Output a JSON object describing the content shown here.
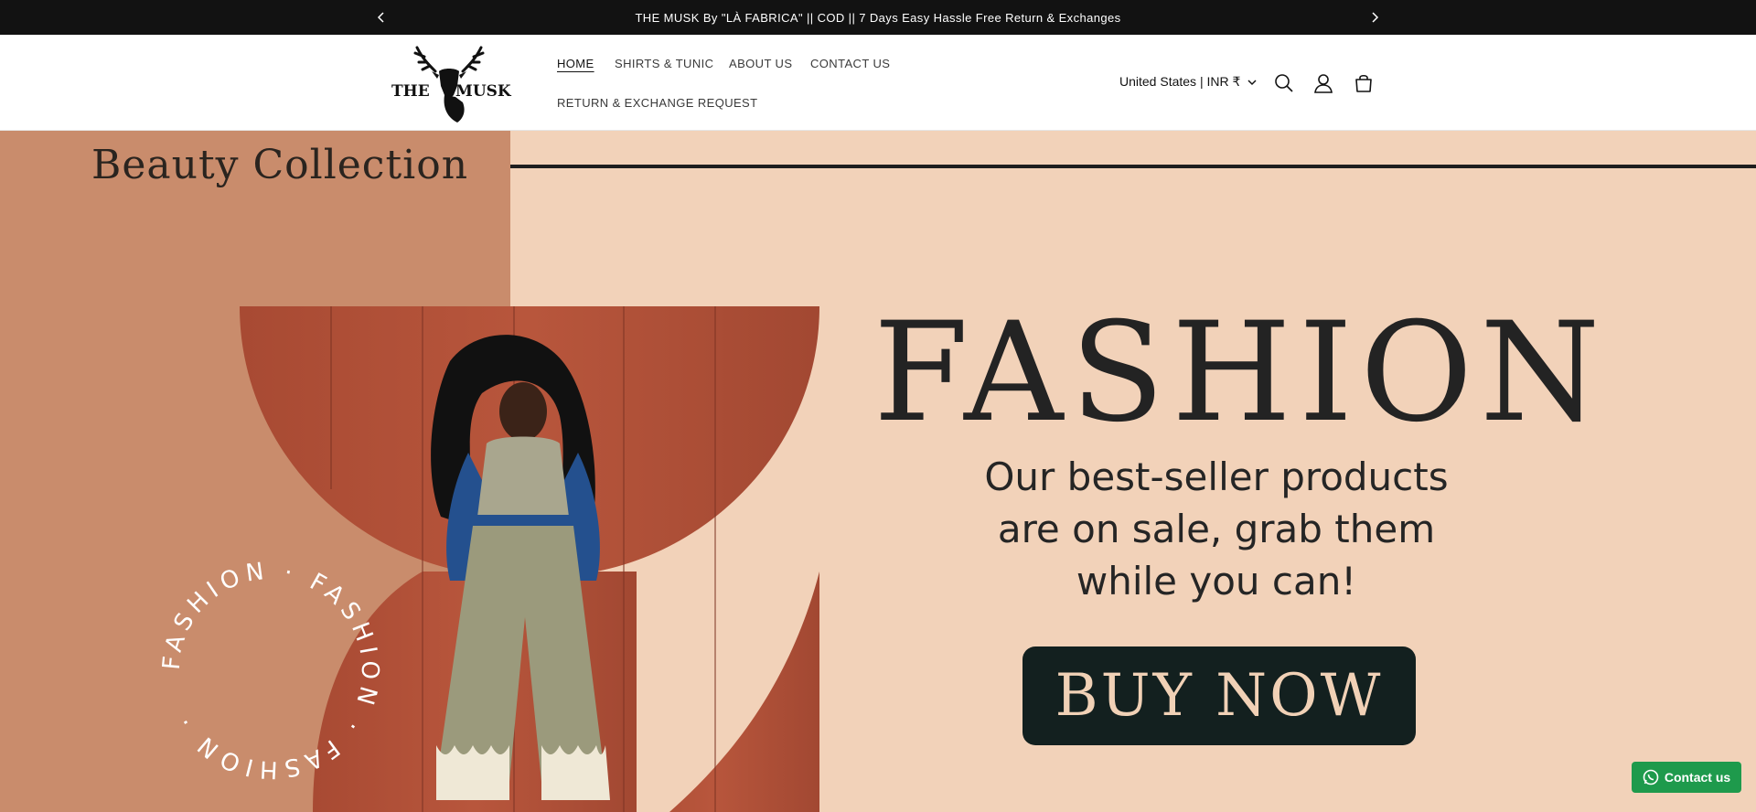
{
  "announcement": {
    "message": "THE MUSK By \"LÀ FABRICA\" || COD || 7 Days Easy Hassle Free Return & Exchanges",
    "prev_icon": "chevron-left-icon",
    "next_icon": "chevron-right-icon"
  },
  "header": {
    "logo": {
      "line1": "THE",
      "line2": "MUSK"
    },
    "nav": [
      {
        "label": "HOME",
        "active": true
      },
      {
        "label": "SHIRTS & TUNIC",
        "active": false
      },
      {
        "label": "ABOUT US",
        "active": false
      },
      {
        "label": "CONTACT US",
        "active": false
      },
      {
        "label": "RETURN & EXCHANGE REQUEST",
        "active": false
      }
    ],
    "country_selector": "United States | INR ₹",
    "icons": [
      "search-icon",
      "account-icon",
      "cart-icon"
    ]
  },
  "hero": {
    "small_heading": "Beauty Collection",
    "headline": "FASHION",
    "tagline_lines": [
      "Our best-seller products",
      "are on sale, grab them",
      "while you can!"
    ],
    "cta": "BUY NOW",
    "circular_text": "FASHION · FASHION · FASHION ·"
  },
  "whatsapp": {
    "label": "Contact us",
    "icon": "whatsapp-icon"
  },
  "colors": {
    "announcement_bg": "#121212",
    "hero_bg": "#f2d2b9",
    "hero_accent_block": "#c98c6c",
    "photo_wall": "#b5523a",
    "cta_bg": "#13201f",
    "whatsapp_green": "#1e9a4c"
  }
}
